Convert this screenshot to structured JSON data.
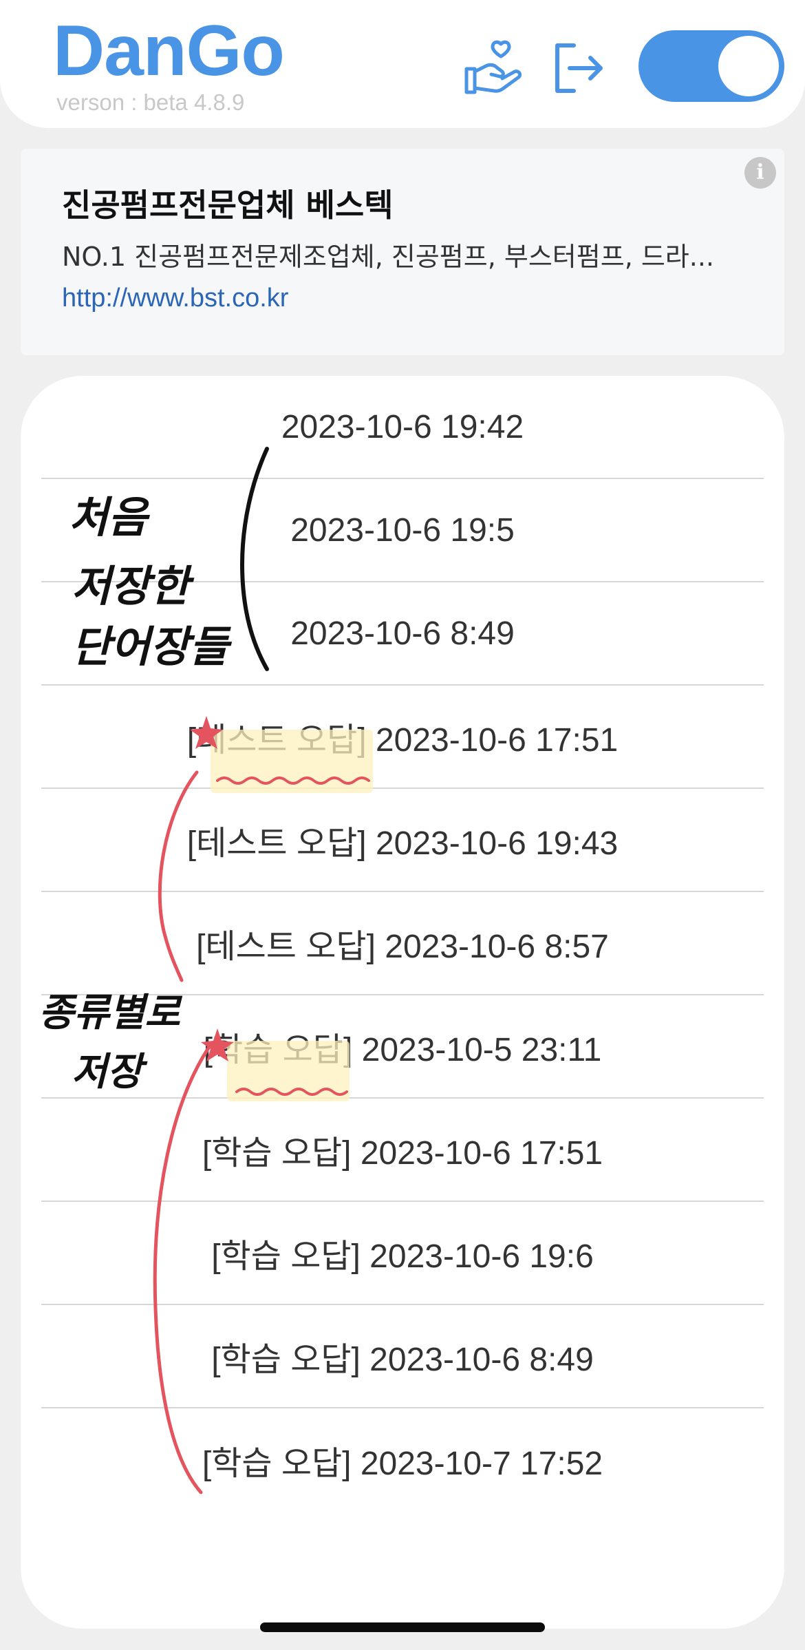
{
  "header": {
    "app_name": "DanGo",
    "version_label": "verson : beta 4.8.9",
    "toggle_on": true,
    "accent_color": "#4a94e6"
  },
  "ad": {
    "title": "진공펌프전문업체 베스텍",
    "description": "NO.1 진공펌프전문제조업체, 진공펌프, 부스터펌프, 드라...",
    "link": "http://www.bst.co.kr",
    "info_label": "i"
  },
  "list": {
    "items": [
      {
        "label": "2023-10-6 19:42"
      },
      {
        "label": "2023-10-6 19:5"
      },
      {
        "label": "2023-10-6 8:49"
      },
      {
        "label": "[테스트 오답] 2023-10-6 17:51"
      },
      {
        "label": "[테스트 오답] 2023-10-6 19:43"
      },
      {
        "label": "[테스트 오답] 2023-10-6 8:57"
      },
      {
        "label": "[학습 오답] 2023-10-5 23:11"
      },
      {
        "label": "[학습 오답] 2023-10-6 17:51"
      },
      {
        "label": "[학습 오답] 2023-10-6 19:6"
      },
      {
        "label": "[학습 오답] 2023-10-6 8:49"
      },
      {
        "label": "[학습 오답] 2023-10-7 17:52"
      }
    ]
  },
  "annotations": {
    "first_saved": [
      "처음",
      "저장한",
      "단어장들"
    ],
    "by_type": [
      "종류별로",
      "저장"
    ]
  }
}
